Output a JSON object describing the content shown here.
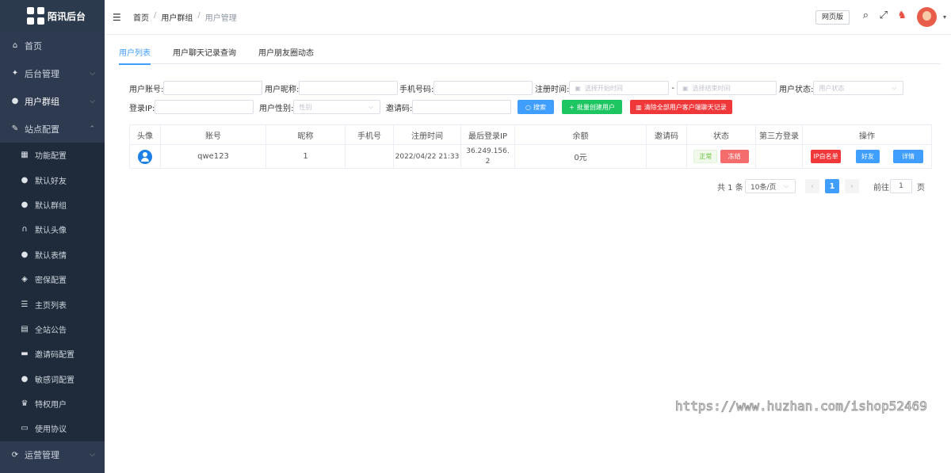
{
  "app": {
    "title": "陌讯后台"
  },
  "sidebar": {
    "items": [
      {
        "label": "首页",
        "icon": "home-icon"
      },
      {
        "label": "后台管理",
        "icon": "gear-icon"
      },
      {
        "label": "用户群组",
        "icon": "user-icon"
      },
      {
        "label": "站点配置",
        "icon": "wrench-icon"
      }
    ],
    "sub_items": [
      {
        "label": "功能配置",
        "icon": "grid-icon"
      },
      {
        "label": "默认好友",
        "icon": "add-user-icon"
      },
      {
        "label": "默认群组",
        "icon": "users-icon"
      },
      {
        "label": "默认头像",
        "icon": "headset-icon"
      },
      {
        "label": "默认表情",
        "icon": "smile-icon"
      },
      {
        "label": "密保配置",
        "icon": "shield-icon"
      },
      {
        "label": "主页列表",
        "icon": "list-icon"
      },
      {
        "label": "全站公告",
        "icon": "notice-icon"
      },
      {
        "label": "邀请码配置",
        "icon": "message-icon"
      },
      {
        "label": "敏感词配置",
        "icon": "warning-icon"
      },
      {
        "label": "特权用户",
        "icon": "vip-icon"
      },
      {
        "label": "使用协议",
        "icon": "document-icon"
      }
    ],
    "bottom_item": {
      "label": "运营管理",
      "icon": "operation-icon"
    }
  },
  "header": {
    "breadcrumb": [
      "首页",
      "用户群组",
      "用户管理"
    ],
    "web_version": "网页版"
  },
  "tabs": [
    "用户列表",
    "用户聊天记录查询",
    "用户朋友圈动态"
  ],
  "filters": {
    "account_label": "用户账号:",
    "nickname_label": "用户昵称:",
    "phone_label": "手机号码:",
    "regtime_label": "注册时间:",
    "start_placeholder": "选择开始时间",
    "end_placeholder": "选择结束时间",
    "status_label": "用户状态:",
    "status_placeholder": "用户状态",
    "ip_label": "登录IP:",
    "gender_label": "用户性别:",
    "gender_placeholder": "性别",
    "invite_label": "邀请码:"
  },
  "buttons": {
    "search": "搜索",
    "batch_create": "批量创建用户",
    "clear_chat": "清除全部用户客户端聊天记录"
  },
  "colors": {
    "primary": "#409eff",
    "success": "#1ec661",
    "danger": "#f0383b",
    "sidebar": "#2e3a4f"
  },
  "table": {
    "columns": [
      "头像",
      "账号",
      "昵称",
      "手机号",
      "注册时间",
      "最后登录IP",
      "余额",
      "邀请码",
      "状态",
      "第三方登录",
      "操作"
    ],
    "rows": [
      {
        "account": "qwe123",
        "nickname": "1",
        "phone": "",
        "reg_time": "2022/04/22 21:33",
        "last_ip": "36.249.156.2",
        "balance": "0元",
        "invite": "",
        "status_tag": "正常",
        "freeze": "冻结",
        "third": "",
        "actions": [
          "IP白名单",
          "好友",
          "详情"
        ]
      }
    ]
  },
  "pagination": {
    "total": "共 1 条",
    "page_size": "10条/页",
    "current": "1",
    "goto_label": "前往",
    "goto_value": "1",
    "page_suffix": "页"
  },
  "watermark": "https://www.huzhan.com/ishop52469"
}
